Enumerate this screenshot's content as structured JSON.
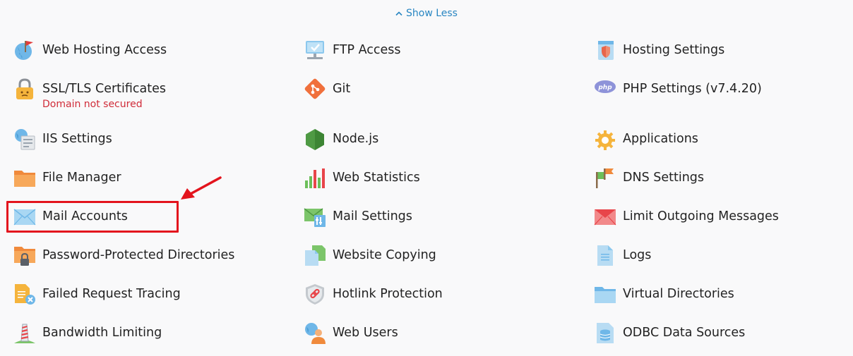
{
  "toggle": {
    "label": "Show Less",
    "chevron": "chevron-up-icon"
  },
  "colors": {
    "link": "#2986c2",
    "warning": "#d02c39",
    "highlight": "#e3141d"
  },
  "items": [
    {
      "label": "Web Hosting Access",
      "icon": "globe-flag-icon"
    },
    {
      "label": "FTP Access",
      "icon": "ftp-monitor-icon"
    },
    {
      "label": "Hosting Settings",
      "icon": "hosting-shield-icon"
    },
    {
      "label": "SSL/TLS Certificates",
      "sublabel": "Domain not secured",
      "icon": "padlock-icon"
    },
    {
      "label": "Git",
      "icon": "git-icon"
    },
    {
      "label": "PHP Settings (v7.4.20)",
      "icon": "php-icon"
    },
    {
      "label": "IIS Settings",
      "icon": "iis-server-icon"
    },
    {
      "label": "Node.js",
      "icon": "nodejs-hexagon-icon"
    },
    {
      "label": "Applications",
      "icon": "gear-icon"
    },
    {
      "label": "File Manager",
      "icon": "folder-icon"
    },
    {
      "label": "Web Statistics",
      "icon": "bar-chart-icon"
    },
    {
      "label": "DNS Settings",
      "icon": "dns-flags-icon"
    },
    {
      "label": "Mail Accounts",
      "icon": "envelope-icon"
    },
    {
      "label": "Mail Settings",
      "icon": "mail-settings-icon"
    },
    {
      "label": "Limit Outgoing Messages",
      "icon": "envelope-red-icon"
    },
    {
      "label": "Password-Protected Directories",
      "icon": "locked-folder-icon"
    },
    {
      "label": "Website Copying",
      "icon": "copy-pages-icon"
    },
    {
      "label": "Logs",
      "icon": "log-document-icon"
    },
    {
      "label": "Failed Request Tracing",
      "icon": "failed-request-icon"
    },
    {
      "label": "Hotlink Protection",
      "icon": "hotlink-shield-icon"
    },
    {
      "label": "Virtual Directories",
      "icon": "virtual-folder-icon"
    },
    {
      "label": "Bandwidth Limiting",
      "icon": "bandwidth-tower-icon"
    },
    {
      "label": "Web Users",
      "icon": "web-user-icon"
    },
    {
      "label": "ODBC Data Sources",
      "icon": "database-icon"
    }
  ]
}
